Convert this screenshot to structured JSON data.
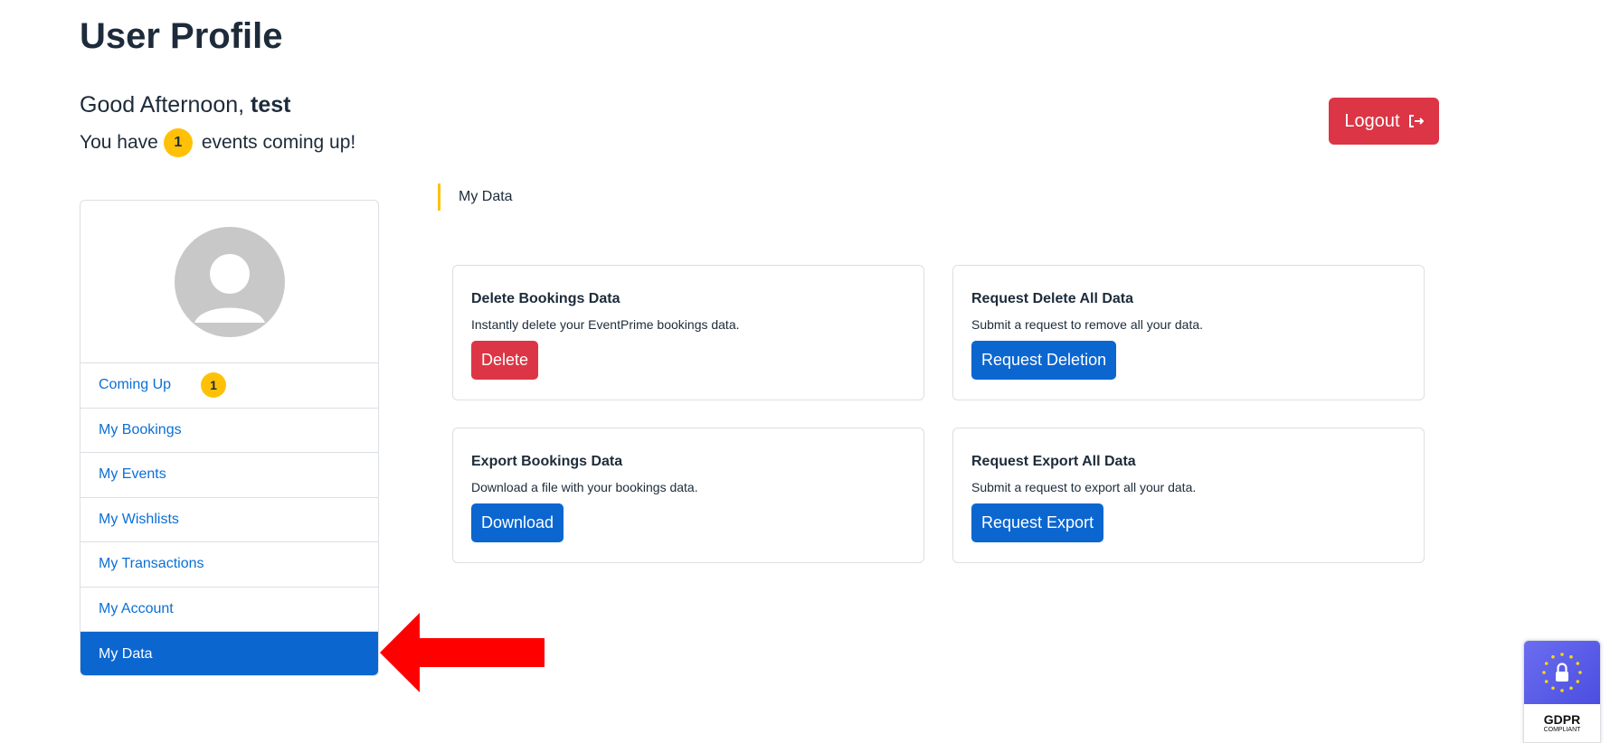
{
  "header": {
    "title": "User Profile",
    "greeting_prefix": "Good Afternoon,",
    "username": "test",
    "events_prefix": "You have",
    "events_count": "1",
    "events_suffix": "events coming up!",
    "logout_label": "Logout"
  },
  "sidebar": {
    "items": [
      {
        "label": "Coming Up",
        "badge": "1"
      },
      {
        "label": "My Bookings"
      },
      {
        "label": "My Events"
      },
      {
        "label": "My Wishlists"
      },
      {
        "label": "My Transactions"
      },
      {
        "label": "My Account"
      },
      {
        "label": "My Data",
        "active": true
      }
    ]
  },
  "main": {
    "section_title": "My Data",
    "cards": [
      {
        "title": "Delete Bookings Data",
        "desc": "Instantly delete your EventPrime bookings data.",
        "button": "Delete"
      },
      {
        "title": "Request Delete All Data",
        "desc": "Submit a request to remove all your data.",
        "button": "Request Deletion"
      },
      {
        "title": "Export Bookings Data",
        "desc": "Download a file with your bookings data.",
        "button": "Download"
      },
      {
        "title": "Request Export All Data",
        "desc": "Submit a request to export all your data.",
        "button": "Request Export"
      }
    ]
  },
  "gdpr_badge": {
    "title": "GDPR",
    "subtitle": "COMPLIANT"
  },
  "colors": {
    "accent": "#0b66d0",
    "danger": "#dc3545",
    "badge": "#ffc107",
    "arrow": "#ff0000"
  }
}
